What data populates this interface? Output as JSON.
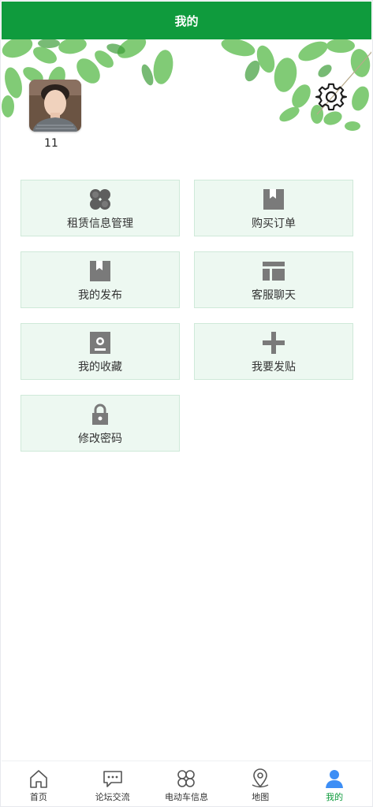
{
  "header": {
    "title": "我的"
  },
  "profile": {
    "username": "11"
  },
  "menu": [
    {
      "label": "租赁信息管理",
      "icon": "clover-icon"
    },
    {
      "label": "购买订单",
      "icon": "bookmark-icon"
    },
    {
      "label": "我的发布",
      "icon": "bookmark-icon"
    },
    {
      "label": "客服聊天",
      "icon": "layout-icon"
    },
    {
      "label": "我的收藏",
      "icon": "contact-icon"
    },
    {
      "label": "我要发贴",
      "icon": "plus-icon"
    },
    {
      "label": "修改密码",
      "icon": "lock-icon"
    }
  ],
  "tabbar": [
    {
      "label": "首页",
      "icon": "home-icon"
    },
    {
      "label": "论坛交流",
      "icon": "chat-icon"
    },
    {
      "label": "电动车信息",
      "icon": "clover-icon"
    },
    {
      "label": "地图",
      "icon": "location-pin-icon"
    },
    {
      "label": "我的",
      "icon": "user-icon",
      "active": true
    }
  ],
  "colors": {
    "accent": "#0f9b3d",
    "card_bg": "#edf8f1",
    "icon_gray": "#7a7a7a",
    "active_blue": "#3d8ef5"
  }
}
